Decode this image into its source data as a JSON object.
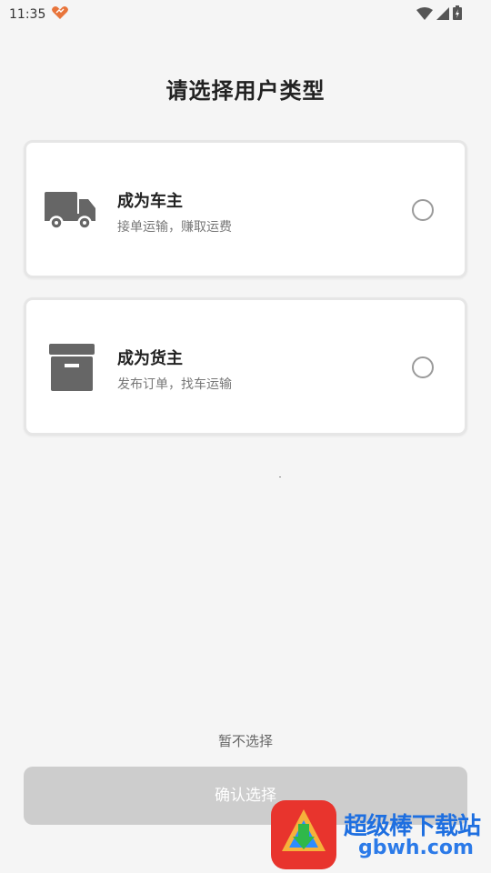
{
  "status_bar": {
    "time": "11:35"
  },
  "page": {
    "title": "请选择用户类型"
  },
  "options": [
    {
      "title": "成为车主",
      "description": "接单运输，赚取运费",
      "icon": "truck-icon",
      "selected": false
    },
    {
      "title": "成为货主",
      "description": "发布订单，找车运输",
      "icon": "archive-box-icon",
      "selected": false
    }
  ],
  "actions": {
    "skip_label": "暂不选择",
    "confirm_label": "确认选择"
  },
  "watermark": {
    "brand": "超级棒下载站",
    "site": "gbwh.com"
  },
  "colors": {
    "background": "#f5f5f5",
    "card": "#ffffff",
    "icon": "#666666",
    "button_disabled": "#cdcdcd",
    "radio_border": "#9a9a9a"
  }
}
